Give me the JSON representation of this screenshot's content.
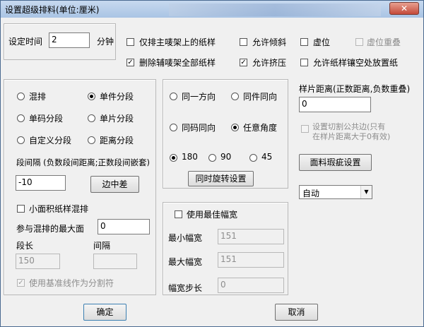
{
  "window": {
    "title": "设置超级排料(单位:厘米)",
    "close_icon": "✕"
  },
  "top": {
    "time_label": "设定时间",
    "time_value": "2",
    "time_unit": "分钟",
    "only_main_label": "仅排主唛架上的纸样",
    "delete_aux_label": "删除辅唛架全部纸样",
    "allow_tilt_label": "允许倾斜",
    "allow_squeeze_label": "允许挤压",
    "virtual_label": "虚位",
    "virtual_overlap_label": "虚位重叠",
    "allow_gap_label": "允许纸样镶空处放置纸"
  },
  "layout_group": {
    "mixed": "混排",
    "single_piece": "单件分段",
    "single_code": "单码分段",
    "single_sheet": "单片分段",
    "custom": "自定义分段",
    "distance": "距离分段",
    "seg_gap_label": "段间隔 (负数段间距离;正数段间嵌套)",
    "seg_gap_value": "-10",
    "edge_diff_button": "边中差",
    "small_area_label": "小面积纸样混排",
    "max_area_label": "参与混排的最大面",
    "max_area_value": "0",
    "seg_len_label": "段长",
    "seg_len_value": "150",
    "interval_label": "间隔",
    "interval_value": "",
    "baseline_label": "使用基准线作为分割符"
  },
  "direction_group": {
    "same_dir": "同一方向",
    "same_piece": "同件同向",
    "same_code": "同码同向",
    "any_angle": "任意角度",
    "a180": "180",
    "a90": "90",
    "a45": "45",
    "rotate_button": "同时旋转设置"
  },
  "width_group": {
    "use_best_label": "使用最佳幅宽",
    "min_label": "最小幅宽",
    "min_value": "151",
    "max_label": "最大幅宽",
    "max_value": "151",
    "step_label": "幅宽步长",
    "step_value": "0"
  },
  "right": {
    "sample_dist_label": "样片距离(正数距离,负数重叠)",
    "sample_dist_value": "0",
    "cut_line1": "设置切割公共边(只有",
    "cut_line2": "在样片距离大于0有效)",
    "fabric_button": "面料瑕疵设置",
    "auto_value": "自动"
  },
  "footer": {
    "ok": "确定",
    "cancel": "取消"
  }
}
